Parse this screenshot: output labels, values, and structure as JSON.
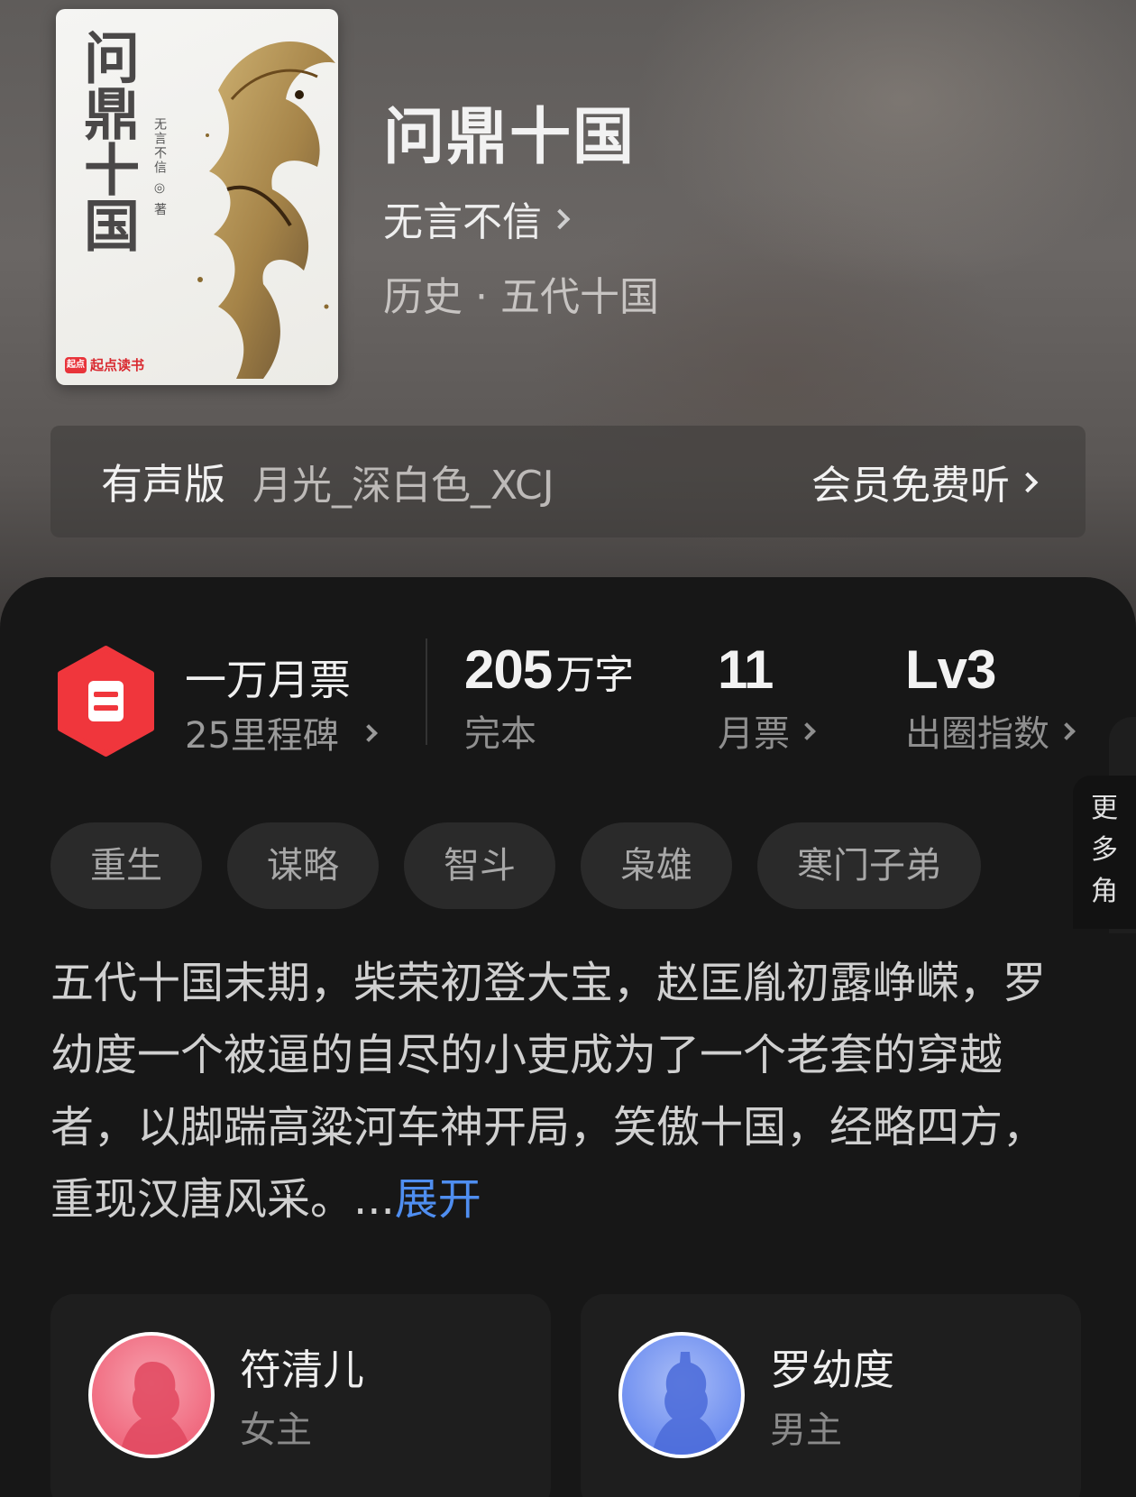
{
  "book": {
    "title": "问鼎十国",
    "author": "无言不信",
    "genre": "历史 · 五代十国",
    "cover": {
      "title": "问鼎十国",
      "author_line": "无言不信 ◎ 著",
      "publisher": "起点读书",
      "publisher_mark": "起点"
    }
  },
  "audio": {
    "label": "有声版",
    "narrator": "月光_深白色_XCJ",
    "cta": "会员免费听"
  },
  "stats": {
    "ticket_title": "一万月票",
    "ticket_sub": "25里程碑",
    "word_count": "205",
    "word_unit": "万字",
    "status": "完本",
    "monthly_tickets": "11",
    "monthly_label": "月票",
    "level": "Lv3",
    "level_label": "出圈指数"
  },
  "tags": [
    "重生",
    "谋略",
    "智斗",
    "枭雄",
    "寒门子弟"
  ],
  "synopsis": {
    "text": "五代十国末期，柴荣初登大宝，赵匡胤初露峥嵘，罗幼度一个被逼的自尽的小吏成为了一个老套的穿越者，以脚踹高粱河车神开局，笑傲十国，经略四方，重现汉唐风采。...",
    "expand": "展开"
  },
  "characters": [
    {
      "name": "符清儿",
      "role": "女主",
      "avatar_color": "#f06b80"
    },
    {
      "name": "罗幼度",
      "role": "男主",
      "avatar_color": "#6f8ff0"
    }
  ],
  "more_roles": [
    "更",
    "多",
    "角"
  ],
  "colors": {
    "accent_red": "#f0363c",
    "link_blue": "#4f8ef0"
  },
  "icons": {
    "author_chevron": "chevron-right-icon",
    "badge": "ticket-badge-icon"
  }
}
